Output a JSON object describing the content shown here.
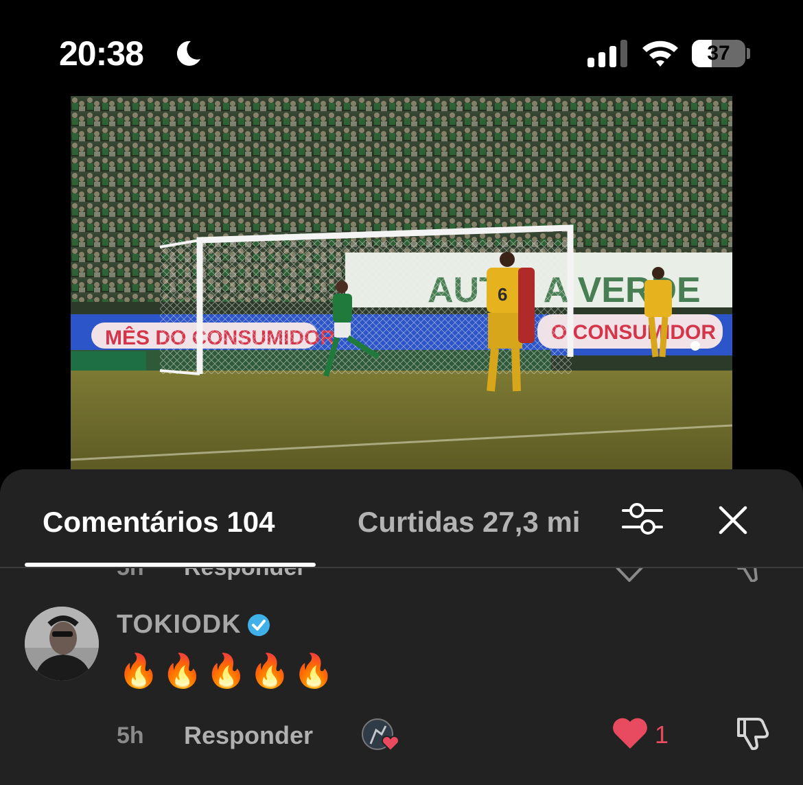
{
  "status_bar": {
    "time": "20:38",
    "battery_level": "37",
    "battery_fraction": 0.37,
    "icons": [
      "moon-icon",
      "signal-icon",
      "wifi-icon",
      "battery-icon"
    ]
  },
  "video": {
    "description_icon": "video-thumbnail"
  },
  "tabs": {
    "comments_label": "Comentários 104",
    "likes_label": "Curtidas 27,3 mi"
  },
  "toolbar_icons": [
    "filter-icon",
    "close-icon"
  ],
  "comment": {
    "username": "TOKIODK",
    "verified": true,
    "text": "🔥🔥🔥🔥🔥",
    "time": "5h",
    "reply_label": "Responder",
    "like_count": "1",
    "liked_by_creator": true
  },
  "colors": {
    "sheet_background": "#222222",
    "like_red": "#e84a5f",
    "verified_blue": "#3fb1e8",
    "active_tab": "#ffffff",
    "inactive_tab": "#b3b3b3"
  }
}
